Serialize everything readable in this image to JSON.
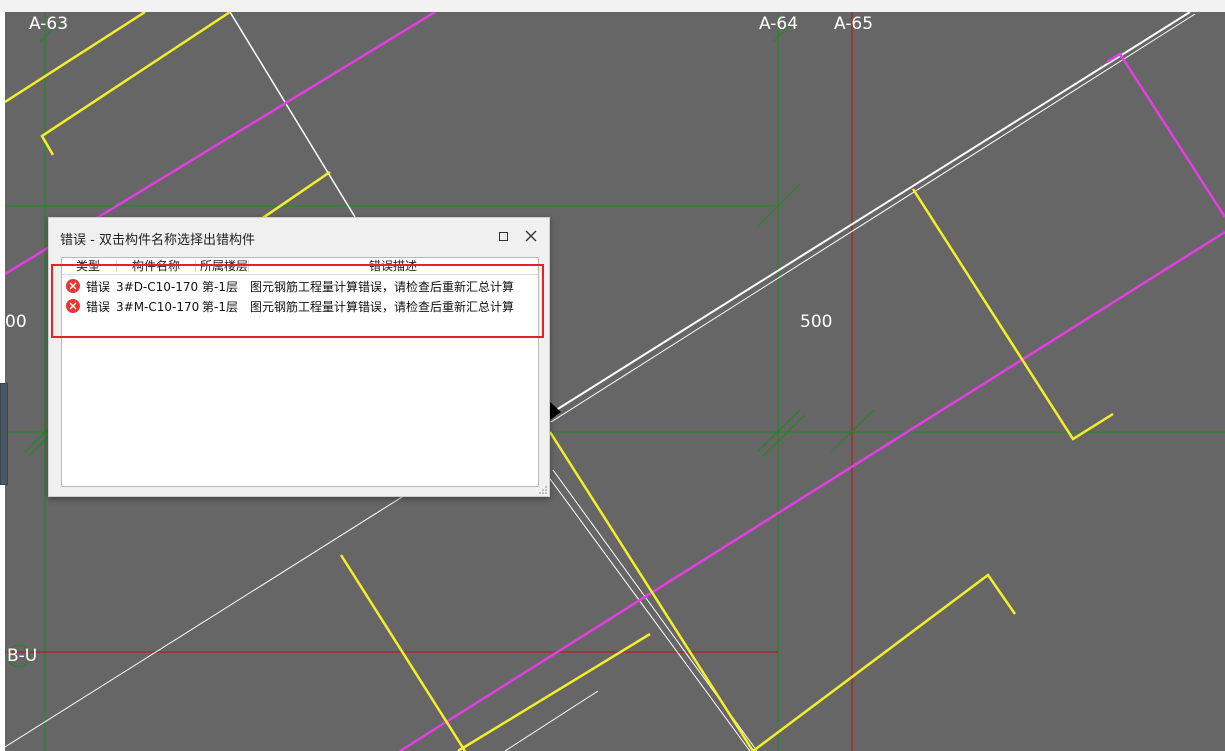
{
  "canvas": {
    "background": "#666666",
    "axis_labels": {
      "top_left": "A-63",
      "top_mid": "A-64",
      "top_right": "A-65",
      "dim_left": "00",
      "dim_right": "500",
      "bottom_left": "B-U"
    },
    "colors": {
      "axis_green": "#1f8a1f",
      "axis_red": "#c01010",
      "rebar_yellow": "#f5ef2a",
      "magenta": "#e43ee4",
      "white": "#ffffff"
    }
  },
  "dialog": {
    "title": "错误 - 双击构件名称选择出错构件",
    "maximize_icon": "maximize-icon",
    "close_icon": "close-icon",
    "columns": [
      "类型",
      "构件名称",
      "所属楼层",
      "错误描述"
    ],
    "rows": [
      {
        "type": "错误",
        "name": "3#D-C10-170",
        "floor": "第-1层",
        "desc": "图元钢筋工程量计算错误，请检查后重新汇总计算",
        "icon": "error-icon"
      },
      {
        "type": "错误",
        "name": "3#M-C10-170",
        "floor": "第-1层",
        "desc": "图元钢筋工程量计算错误，请检查后重新汇总计算",
        "icon": "error-icon"
      }
    ],
    "highlight_color": "#e8202a"
  }
}
